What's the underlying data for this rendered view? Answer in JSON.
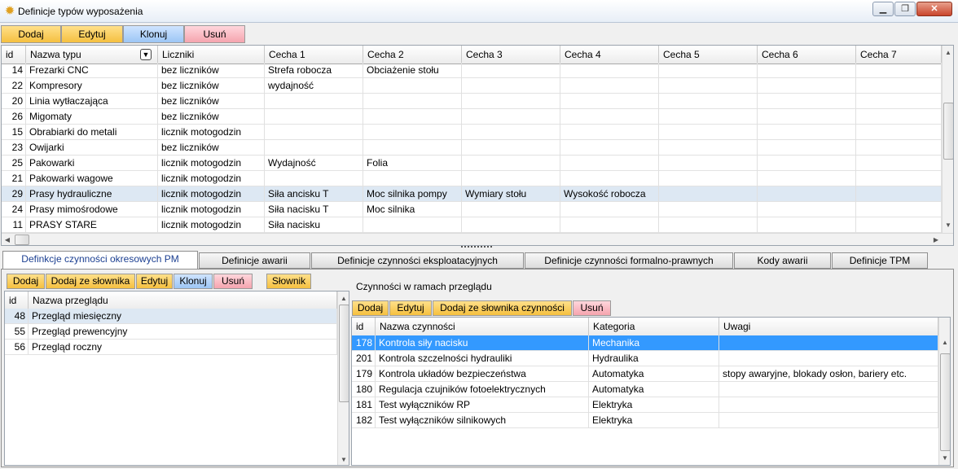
{
  "window": {
    "title": "Definicje typów wyposażenia",
    "icon": "gear-icon",
    "buttons": {
      "minimize": "▁",
      "maximize": "❐",
      "close": "✕"
    }
  },
  "toolbar": {
    "add": "Dodaj",
    "edit": "Edytuj",
    "clone": "Klonuj",
    "delete": "Usuń"
  },
  "colors": {
    "yellow": "#f5c040",
    "blue": "#9cc6f5",
    "red": "#f5a4ae",
    "selection": "#3399ff"
  },
  "main_table": {
    "columns": [
      "id",
      "Nazwa typu",
      "Liczniki",
      "Cecha 1",
      "Cecha 2",
      "Cecha 3",
      "Cecha 4",
      "Cecha 5",
      "Cecha 6",
      "Cecha 7"
    ],
    "rows": [
      [
        "14",
        "Frezarki CNC",
        "bez liczników",
        "Strefa robocza",
        "Obciażenie stołu",
        "",
        "",
        "",
        "",
        ""
      ],
      [
        "22",
        "Kompresory",
        "bez liczników",
        "wydajność",
        "",
        "",
        "",
        "",
        "",
        ""
      ],
      [
        "20",
        "Linia wytłaczająca",
        "bez liczników",
        "",
        "",
        "",
        "",
        "",
        "",
        ""
      ],
      [
        "26",
        "Migomaty",
        "bez liczników",
        "",
        "",
        "",
        "",
        "",
        "",
        ""
      ],
      [
        "15",
        "Obrabiarki do metali",
        "licznik motogodzin",
        "",
        "",
        "",
        "",
        "",
        "",
        ""
      ],
      [
        "23",
        "Owijarki",
        "bez liczników",
        "",
        "",
        "",
        "",
        "",
        "",
        ""
      ],
      [
        "25",
        "Pakowarki",
        "licznik motogodzin",
        "Wydajność",
        "Folia",
        "",
        "",
        "",
        "",
        ""
      ],
      [
        "21",
        "Pakowarki wagowe",
        "licznik motogodzin",
        "",
        "",
        "",
        "",
        "",
        "",
        ""
      ],
      [
        "29",
        "Prasy hydrauliczne",
        "licznik motogodzin",
        "Siła ancisku T",
        "Moc silnika pompy",
        "Wymiary stołu",
        "Wysokość robocza",
        "",
        "",
        ""
      ],
      [
        "24",
        "Prasy mimośrodowe",
        "licznik motogodzin",
        "Siła nacisku T",
        "Moc silnika",
        "",
        "",
        "",
        "",
        ""
      ],
      [
        "11",
        "PRASY STARE",
        "licznik motogodzin",
        "Siła nacisku",
        "",
        "",
        "",
        "",
        "",
        ""
      ]
    ],
    "selected_index": 8
  },
  "tabs": [
    "Definkcje czynności okresowych PM",
    "Definicje awarii",
    "Definicje czynności eksploatacyjnych",
    "Definicje czynności formalno-prawnych",
    "Kody awarii",
    "Definicje TPM"
  ],
  "left_panel": {
    "buttons": {
      "add": "Dodaj",
      "add_dict": "Dodaj ze słownika",
      "edit": "Edytuj",
      "clone": "Klonuj",
      "delete": "Usuń",
      "dictionary": "Słownik"
    },
    "columns": [
      "id",
      "Nazwa przeglądu"
    ],
    "rows": [
      [
        "48",
        "Przegląd miesięczny"
      ],
      [
        "55",
        "Przegląd prewencyjny"
      ],
      [
        "56",
        "Przegląd roczny"
      ]
    ]
  },
  "right_panel": {
    "title": "Czynności w ramach przeglądu",
    "buttons": {
      "add": "Dodaj",
      "edit": "Edytuj",
      "add_dict": "Dodaj ze słownika czynności",
      "delete": "Usuń"
    },
    "columns": [
      "id",
      "Nazwa czynności",
      "Kategoria",
      "Uwagi"
    ],
    "rows": [
      [
        "178",
        "Kontrola siły nacisku",
        "Mechanika",
        ""
      ],
      [
        "201",
        "Kontrola szczelności hydrauliki",
        "Hydraulika",
        ""
      ],
      [
        "179",
        "Kontrola układów bezpieczeństwa",
        "Automatyka",
        "stopy awaryjne, blokady osłon, bariery etc."
      ],
      [
        "180",
        "Regulacja czujników fotoelektrycznych",
        "Automatyka",
        ""
      ],
      [
        "181",
        "Test wyłączników RP",
        "Elektryka",
        ""
      ],
      [
        "182",
        "Test wyłączników silnikowych",
        "Elektryka",
        ""
      ]
    ]
  },
  "icons": {
    "filter": "filter-icon",
    "splitter": "splitter-grip-icon"
  }
}
